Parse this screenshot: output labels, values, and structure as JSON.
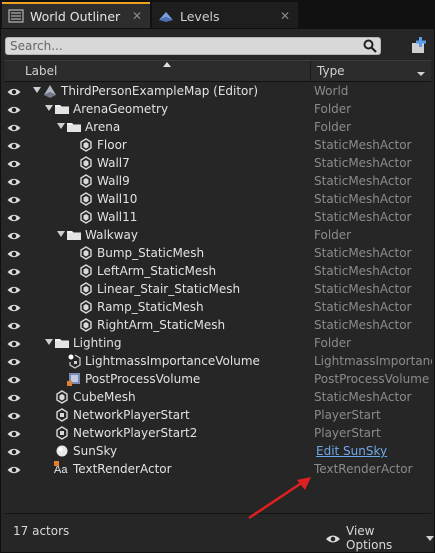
{
  "tabs": [
    {
      "label": "World Outliner",
      "icon": "outliner-icon",
      "close": "✕"
    },
    {
      "label": "Levels",
      "icon": "levels-icon",
      "close": "✕"
    }
  ],
  "search": {
    "placeholder": "Search...",
    "value": ""
  },
  "columns": {
    "label": "Label",
    "type": "Type"
  },
  "rows": [
    {
      "name": "ThirdPersonExampleMap (Editor)",
      "type": "World",
      "icon": "world-icon",
      "depth": 0,
      "expanded": true
    },
    {
      "name": "ArenaGeometry",
      "type": "Folder",
      "icon": "folder-icon",
      "depth": 1,
      "expanded": true
    },
    {
      "name": "Arena",
      "type": "Folder",
      "icon": "folder-icon",
      "depth": 2,
      "expanded": true
    },
    {
      "name": "Floor",
      "type": "StaticMeshActor",
      "icon": "static-mesh-icon",
      "depth": 3
    },
    {
      "name": "Wall7",
      "type": "StaticMeshActor",
      "icon": "static-mesh-icon",
      "depth": 3
    },
    {
      "name": "Wall9",
      "type": "StaticMeshActor",
      "icon": "static-mesh-icon",
      "depth": 3
    },
    {
      "name": "Wall10",
      "type": "StaticMeshActor",
      "icon": "static-mesh-icon",
      "depth": 3
    },
    {
      "name": "Wall11",
      "type": "StaticMeshActor",
      "icon": "static-mesh-icon",
      "depth": 3
    },
    {
      "name": "Walkway",
      "type": "Folder",
      "icon": "folder-icon",
      "depth": 2,
      "expanded": true
    },
    {
      "name": "Bump_StaticMesh",
      "type": "StaticMeshActor",
      "icon": "static-mesh-icon",
      "depth": 3
    },
    {
      "name": "LeftArm_StaticMesh",
      "type": "StaticMeshActor",
      "icon": "static-mesh-icon",
      "depth": 3
    },
    {
      "name": "Linear_Stair_StaticMesh",
      "type": "StaticMeshActor",
      "icon": "static-mesh-icon",
      "depth": 3
    },
    {
      "name": "Ramp_StaticMesh",
      "type": "StaticMeshActor",
      "icon": "static-mesh-icon",
      "depth": 3
    },
    {
      "name": "RightArm_StaticMesh",
      "type": "StaticMeshActor",
      "icon": "static-mesh-icon",
      "depth": 3
    },
    {
      "name": "Lighting",
      "type": "Folder",
      "icon": "folder-icon",
      "depth": 1,
      "expanded": true
    },
    {
      "name": "LightmassImportanceVolume",
      "type": "LightmassImportance",
      "icon": "lightmass-volume-icon",
      "depth": 2
    },
    {
      "name": "PostProcessVolume",
      "type": "PostProcessVolume",
      "icon": "postprocess-volume-icon",
      "depth": 2
    },
    {
      "name": "CubeMesh",
      "type": "StaticMeshActor",
      "icon": "static-mesh-icon",
      "depth": 1
    },
    {
      "name": "NetworkPlayerStart",
      "type": "PlayerStart",
      "icon": "player-start-icon",
      "depth": 1
    },
    {
      "name": "NetworkPlayerStart2",
      "type": "PlayerStart",
      "icon": "player-start-icon",
      "depth": 1
    },
    {
      "name": "SunSky",
      "type": "Edit SunSky",
      "type_is_link": true,
      "icon": "sphere-icon",
      "depth": 1
    },
    {
      "name": "TextRenderActor",
      "type": "TextRenderActor",
      "icon": "text-render-icon",
      "depth": 1
    }
  ],
  "footer": {
    "count": "17 actors",
    "view_options": "View Options"
  },
  "colors": {
    "accent_tab": "#f0a020",
    "link": "#6fa8e8",
    "annotation_arrow": "#e02020"
  }
}
